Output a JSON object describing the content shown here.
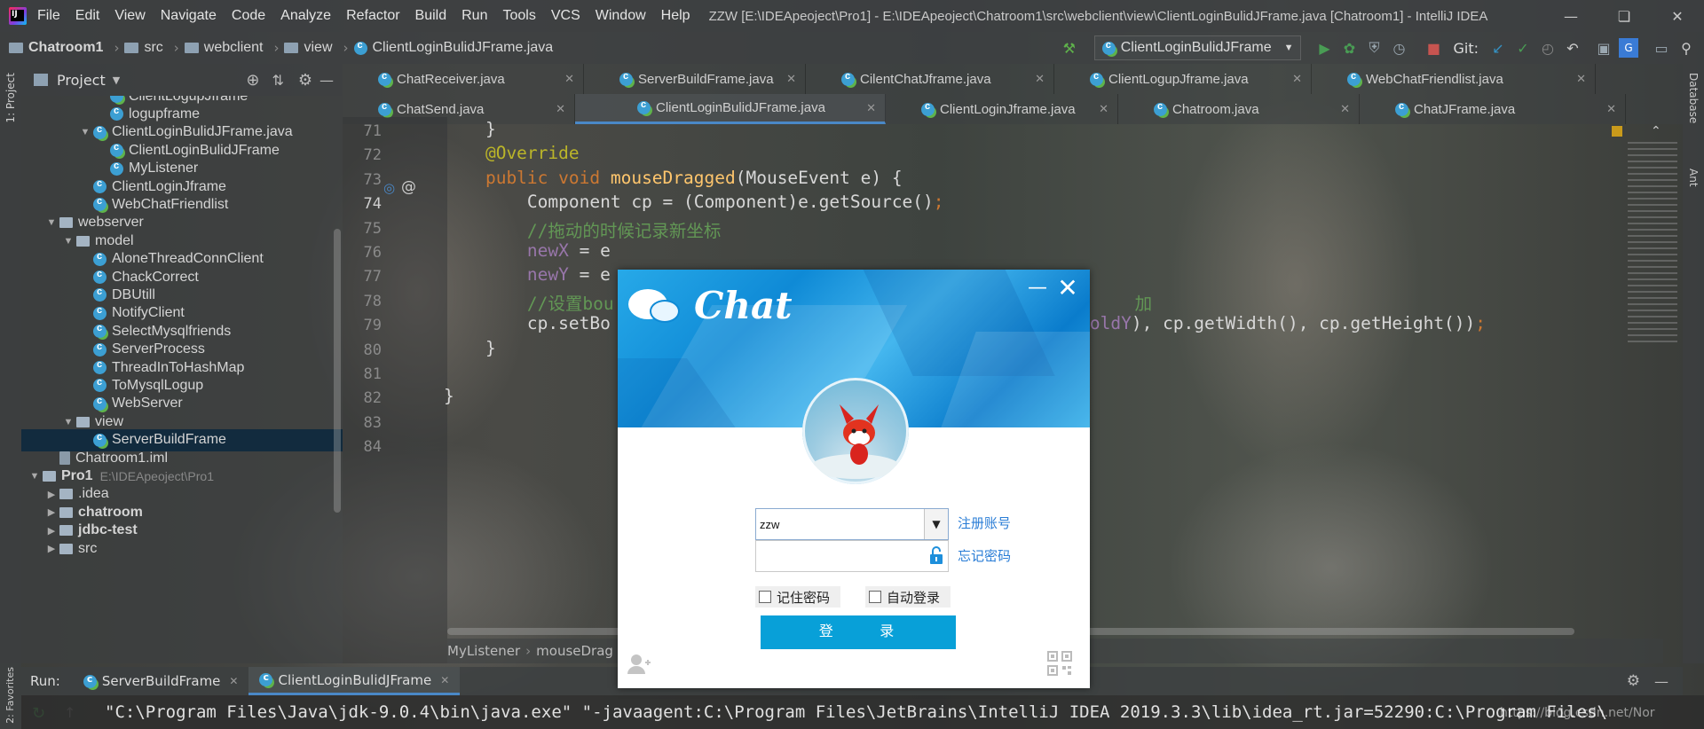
{
  "menubar": {
    "items": [
      "File",
      "Edit",
      "View",
      "Navigate",
      "Code",
      "Analyze",
      "Refactor",
      "Build",
      "Run",
      "Tools",
      "VCS",
      "Window",
      "Help"
    ],
    "title": "ZZW [E:\\IDEApeoject\\Pro1] - E:\\IDEApeoject\\Chatroom1\\src\\webclient\\view\\ClientLoginBulidJFrame.java [Chatroom1] - IntelliJ IDEA"
  },
  "navbar": {
    "crumbs": [
      "Chatroom1",
      "src",
      "webclient",
      "view",
      "ClientLoginBulidJFrame.java"
    ],
    "run_config": "ClientLoginBulidJFrame",
    "git_label": "Git:"
  },
  "project": {
    "header": "Project",
    "tree": [
      {
        "label": "ClientLogupJframe",
        "indent": 4,
        "icon": "class-green"
      },
      {
        "label": "logupframe",
        "indent": 4,
        "icon": "class"
      },
      {
        "label": "ClientLoginBulidJFrame.java",
        "indent": 3,
        "icon": "class-green",
        "arrow": "down"
      },
      {
        "label": "ClientLoginBulidJFrame",
        "indent": 4,
        "icon": "class-green"
      },
      {
        "label": "MyListener",
        "indent": 4,
        "icon": "class"
      },
      {
        "label": "ClientLoginJframe",
        "indent": 3,
        "icon": "class"
      },
      {
        "label": "WebChatFriendlist",
        "indent": 3,
        "icon": "class-green"
      },
      {
        "label": "webserver",
        "indent": 1,
        "icon": "pkg",
        "arrow": "down"
      },
      {
        "label": "model",
        "indent": 2,
        "icon": "pkg",
        "arrow": "down"
      },
      {
        "label": "AloneThreadConnClient",
        "indent": 3,
        "icon": "class"
      },
      {
        "label": "ChackCorrect",
        "indent": 3,
        "icon": "class"
      },
      {
        "label": "DBUtill",
        "indent": 3,
        "icon": "class"
      },
      {
        "label": "NotifyClient",
        "indent": 3,
        "icon": "class"
      },
      {
        "label": "SelectMysqlfriends",
        "indent": 3,
        "icon": "class-green"
      },
      {
        "label": "ServerProcess",
        "indent": 3,
        "icon": "class"
      },
      {
        "label": "ThreadInToHashMap",
        "indent": 3,
        "icon": "class"
      },
      {
        "label": "ToMysqlLogup",
        "indent": 3,
        "icon": "class"
      },
      {
        "label": "WebServer",
        "indent": 3,
        "icon": "class-green"
      },
      {
        "label": "view",
        "indent": 2,
        "icon": "pkg",
        "arrow": "down"
      },
      {
        "label": "ServerBuildFrame",
        "indent": 3,
        "icon": "class-green",
        "selected": true
      },
      {
        "label": "Chatroom1.iml",
        "indent": 1,
        "icon": "file"
      },
      {
        "label": "Pro1",
        "indent": 0,
        "icon": "pkg",
        "arrow": "down",
        "bold": true,
        "path": "E:\\IDEApeoject\\Pro1"
      },
      {
        "label": ".idea",
        "indent": 1,
        "icon": "pkg",
        "arrow": "right"
      },
      {
        "label": "chatroom",
        "indent": 1,
        "icon": "pkg",
        "arrow": "right",
        "bold": true
      },
      {
        "label": "jdbc-test",
        "indent": 1,
        "icon": "pkg",
        "arrow": "right",
        "bold": true
      },
      {
        "label": "src",
        "indent": 1,
        "icon": "pkg",
        "arrow": "right"
      }
    ]
  },
  "tabs": {
    "row1": [
      "ChatReceiver.java",
      "ServerBuildFrame.java",
      "CilentChatJframe.java",
      "ClientLogupJframe.java",
      "WebChatFriendlist.java"
    ],
    "row2": [
      "ChatSend.java",
      "ClientLoginBulidJFrame.java",
      "ClientLoginJframe.java",
      "Chatroom.java",
      "ChatJFrame.java"
    ],
    "active": "ClientLoginBulidJFrame.java"
  },
  "editor": {
    "line_numbers": [
      "71",
      "72",
      "73",
      "74",
      "75",
      "76",
      "77",
      "78",
      "79",
      "80",
      "81",
      "82",
      "83",
      "84"
    ],
    "lines": [
      {
        "n": 0,
        "html": [
          {
            "t": "    }",
            "c": ""
          }
        ]
      },
      {
        "n": 1,
        "html": [
          {
            "t": "    @Override",
            "c": "ann"
          }
        ]
      },
      {
        "n": 2,
        "html": [
          {
            "t": "    public void ",
            "c": "kw"
          },
          {
            "t": "mouseDragged",
            "c": "fn"
          },
          {
            "t": "(MouseEvent e) {",
            "c": ""
          }
        ]
      },
      {
        "n": 3,
        "html": [
          {
            "t": "        Component cp = (Component)e.getSource()",
            "c": ""
          },
          {
            "t": ";",
            "c": "kw"
          }
        ]
      },
      {
        "n": 4,
        "html": [
          {
            "t": "        //拖动的时候记录新坐标",
            "c": "cm"
          }
        ]
      },
      {
        "n": 5,
        "html": [
          {
            "t": "        ",
            "c": ""
          },
          {
            "t": "newX",
            "c": "fld"
          },
          {
            "t": " = e",
            "c": ""
          }
        ]
      },
      {
        "n": 6,
        "html": [
          {
            "t": "        ",
            "c": ""
          },
          {
            "t": "newY",
            "c": "fld"
          },
          {
            "t": " = e",
            "c": ""
          }
        ]
      },
      {
        "n": 7,
        "html": [
          {
            "t": "        //设置bou",
            "c": "cm"
          },
          {
            "t": "                                                  加",
            "c": "cm"
          }
        ]
      },
      {
        "n": 8,
        "html": [
          {
            "t": "        cp.setBo",
            "c": ""
          },
          {
            "t": "                                            - ",
            "c": ""
          },
          {
            "t": "oldY",
            "c": "fld"
          },
          {
            "t": "), cp.getWidth(), cp.getHeight())",
            "c": ""
          },
          {
            "t": ";",
            "c": "kw"
          }
        ]
      },
      {
        "n": 9,
        "html": [
          {
            "t": "    }",
            "c": ""
          }
        ]
      },
      {
        "n": 10,
        "html": [
          {
            "t": "",
            "c": ""
          }
        ]
      },
      {
        "n": 11,
        "html": [
          {
            "t": "}",
            "c": ""
          }
        ]
      }
    ],
    "breadcrumb": [
      "MyListener",
      "mouseDrag"
    ]
  },
  "run": {
    "label": "Run:",
    "tabs": [
      "ServerBuildFrame",
      "ClientLoginBulidJFrame"
    ],
    "console": "\"C:\\Program Files\\Java\\jdk-9.0.4\\bin\\java.exe\" \"-javaagent:C:\\Program Files\\JetBrains\\IntelliJ IDEA 2019.3.3\\lib\\idea_rt.jar=52290:C:\\Program Files\\"
  },
  "side": {
    "left_top": "1: Project",
    "left_bottom": "2: Favorites",
    "right_top": "Database",
    "right_ant": "Ant"
  },
  "dialog": {
    "title": "Chat",
    "username": "zzw",
    "register_link": "注册账号",
    "forgot_link": "忘记密码",
    "remember": "记住密码",
    "auto_login": "自动登录",
    "login_button": "登 录"
  },
  "watermark": "https://blog.csdn.net/Nor"
}
